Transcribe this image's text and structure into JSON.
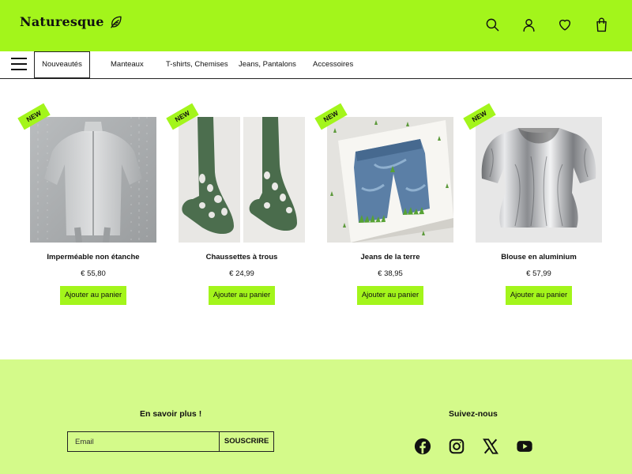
{
  "brand": {
    "name": "Naturesque",
    "icon": "leaf-icon"
  },
  "header_icons": [
    "search-icon",
    "user-icon",
    "heart-icon",
    "shopping-bag-icon"
  ],
  "nav": {
    "menu_icon": "hamburger-menu-icon",
    "items": [
      {
        "label": "Nouveautés",
        "active": true
      },
      {
        "label": "Manteaux"
      },
      {
        "label": "T-shirts, Chemises"
      },
      {
        "label": "Jeans, Pantalons"
      },
      {
        "label": "Accessoires"
      }
    ]
  },
  "products": [
    {
      "name": "Imperméable non étanche",
      "price": "€ 55,80",
      "badge": "NEW",
      "button": "Ajouter au panier"
    },
    {
      "name": "Chaussettes à trous",
      "price": "€ 24,99",
      "badge": "NEW",
      "button": "Ajouter au panier"
    },
    {
      "name": "Jeans de la terre",
      "price": "€ 38,95",
      "badge": "NEW",
      "button": "Ajouter au panier"
    },
    {
      "name": "Blouse en aluminium",
      "price": "€ 57,99",
      "badge": "NEW",
      "button": "Ajouter au panier"
    }
  ],
  "footer": {
    "newsletter": {
      "title": "En savoir plus !",
      "placeholder": "Email",
      "button": "SOUSCRIRE"
    },
    "social": {
      "title": "Suivez-nous",
      "icons": [
        "facebook-icon",
        "instagram-icon",
        "x-icon",
        "youtube-icon"
      ]
    }
  },
  "colors": {
    "accent": "#a3f51b",
    "footer_bg": "#d4fa8a",
    "text": "#111111"
  }
}
